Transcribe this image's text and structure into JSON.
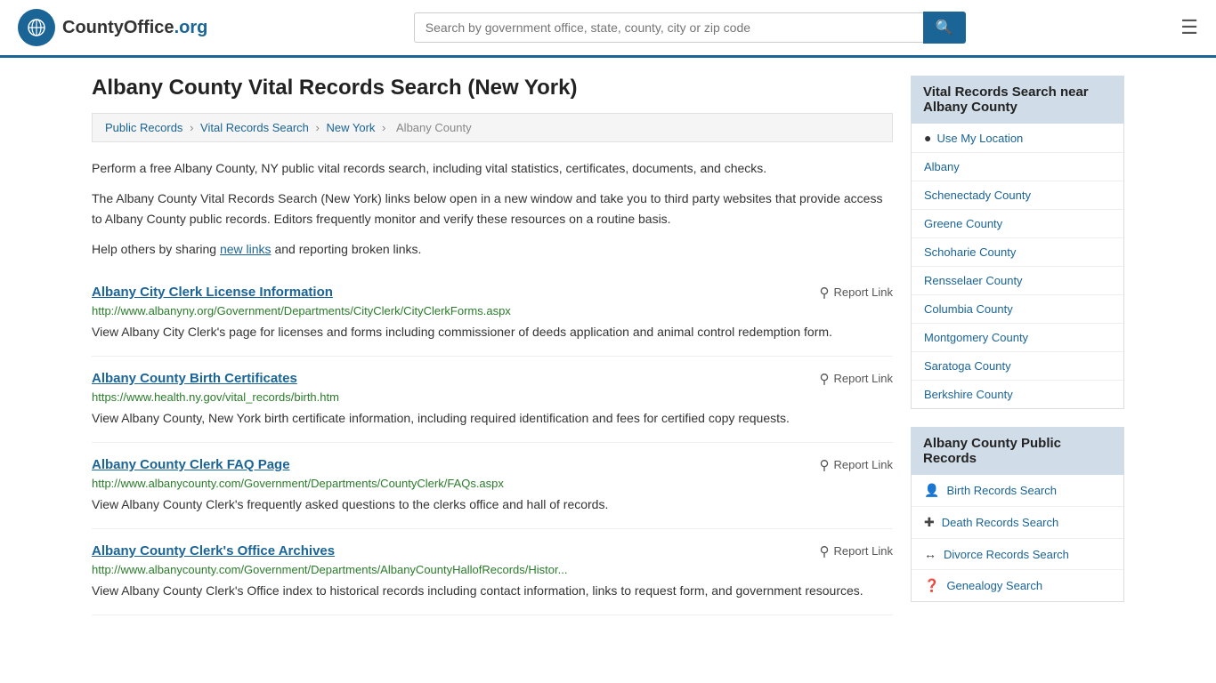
{
  "header": {
    "logo_text": "CountyOffice",
    "logo_org": ".org",
    "search_placeholder": "Search by government office, state, county, city or zip code",
    "search_value": ""
  },
  "page": {
    "title": "Albany County Vital Records Search (New York)"
  },
  "breadcrumb": {
    "items": [
      "Public Records",
      "Vital Records Search",
      "New York",
      "Albany County"
    ]
  },
  "description": {
    "para1": "Perform a free Albany County, NY public vital records search, including vital statistics, certificates, documents, and checks.",
    "para2": "The Albany County Vital Records Search (New York) links below open in a new window and take you to third party websites that provide access to Albany County public records. Editors frequently monitor and verify these resources on a routine basis.",
    "para3_prefix": "Help others by sharing ",
    "para3_link": "new links",
    "para3_suffix": " and reporting broken links."
  },
  "records": [
    {
      "title": "Albany City Clerk License Information",
      "url": "http://www.albanyny.org/Government/Departments/CityClerk/CityClerkForms.aspx",
      "description": "View Albany City Clerk's page for licenses and forms including commissioner of deeds application and animal control redemption form.",
      "report_label": "Report Link"
    },
    {
      "title": "Albany County Birth Certificates",
      "url": "https://www.health.ny.gov/vital_records/birth.htm",
      "description": "View Albany County, New York birth certificate information, including required identification and fees for certified copy requests.",
      "report_label": "Report Link"
    },
    {
      "title": "Albany County Clerk FAQ Page",
      "url": "http://www.albanycounty.com/Government/Departments/CountyClerk/FAQs.aspx",
      "description": "View Albany County Clerk's frequently asked questions to the clerks office and hall of records.",
      "report_label": "Report Link"
    },
    {
      "title": "Albany County Clerk's Office Archives",
      "url": "http://www.albanycounty.com/Government/Departments/AlbanyCountyHallofRecords/Histor...",
      "description": "View Albany County Clerk's Office index to historical records including contact information, links to request form, and government resources.",
      "report_label": "Report Link"
    }
  ],
  "sidebar": {
    "nearby_section": {
      "header": "Vital Records Search near Albany County",
      "use_location": "Use My Location",
      "items": [
        "Albany",
        "Schenectady County",
        "Greene County",
        "Schoharie County",
        "Rensselaer County",
        "Columbia County",
        "Montgomery County",
        "Saratoga County",
        "Berkshire County"
      ]
    },
    "public_records_section": {
      "header": "Albany County Public Records",
      "items": [
        {
          "label": "Birth Records Search",
          "icon": "👤"
        },
        {
          "label": "Death Records Search",
          "icon": "✚"
        },
        {
          "label": "Divorce Records Search",
          "icon": "↔"
        },
        {
          "label": "Genealogy Search",
          "icon": "?"
        }
      ]
    }
  }
}
